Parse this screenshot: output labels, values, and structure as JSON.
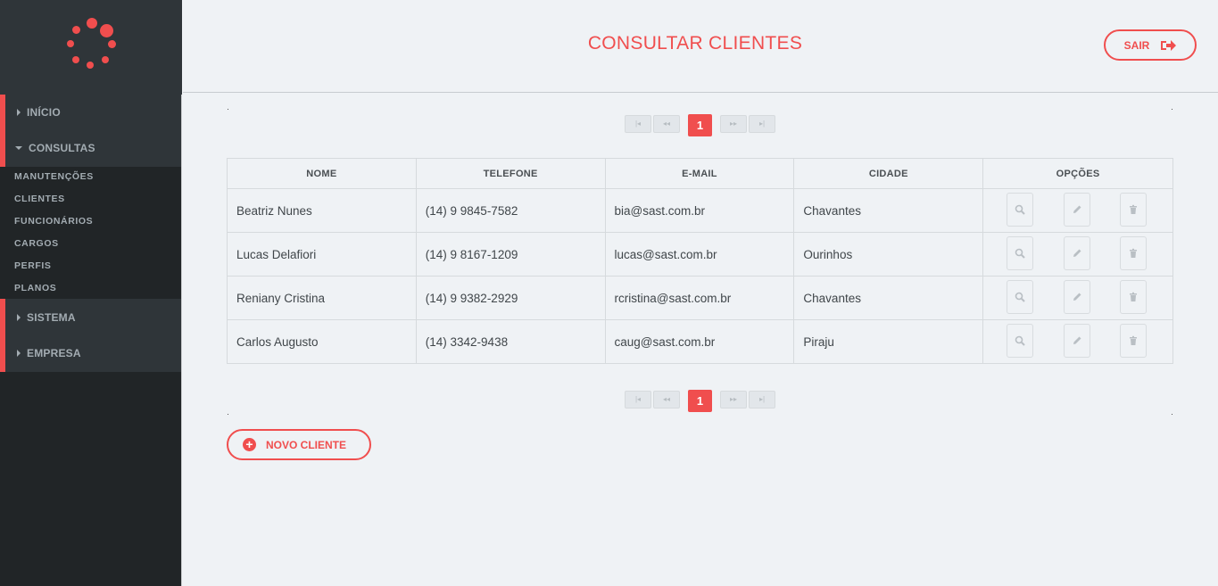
{
  "sidebar": {
    "menu": {
      "inicio": "INÍCIO",
      "consultas": "CONSULTAS",
      "sistema": "SISTEMA",
      "empresa": "EMPRESA"
    },
    "submenu": [
      "MANUTENÇÕES",
      "CLIENTES",
      "FUNCIONÁRIOS",
      "CARGOS",
      "PERFIS",
      "PLANOS"
    ]
  },
  "header": {
    "title": "CONSULTAR CLIENTES",
    "logout_label": "SAIR"
  },
  "pager": {
    "current_page": "1",
    "first_icon": "first-page-icon",
    "prev_icon": "prev-page-icon",
    "next_icon": "next-page-icon",
    "last_icon": "last-page-icon"
  },
  "table": {
    "columns": [
      "NOME",
      "TELEFONE",
      "E-MAIL",
      "CIDADE",
      "OPÇÕES"
    ],
    "rows": [
      {
        "nome": "Beatriz Nunes",
        "telefone": "(14) 9 9845-7582",
        "email": "bia@sast.com.br",
        "cidade": "Chavantes"
      },
      {
        "nome": "Lucas Delafiori",
        "telefone": "(14) 9 8167-1209",
        "email": "lucas@sast.com.br",
        "cidade": "Ourinhos"
      },
      {
        "nome": "Reniany Cristina",
        "telefone": "(14) 9 9382-2929",
        "email": "rcristina@sast.com.br",
        "cidade": "Chavantes"
      },
      {
        "nome": "Carlos Augusto",
        "telefone": "(14) 3342-9438",
        "email": "caug@sast.com.br",
        "cidade": "Piraju"
      }
    ],
    "option_icons": [
      "search-icon",
      "edit-icon",
      "trash-icon"
    ]
  },
  "actions": {
    "new_client_label": "NOVO CLIENTE"
  },
  "colors": {
    "accent": "#f04e4e",
    "sidebar_bg": "#212527",
    "sidebar_block": "#2f3539",
    "page_bg": "#eff2f5"
  }
}
